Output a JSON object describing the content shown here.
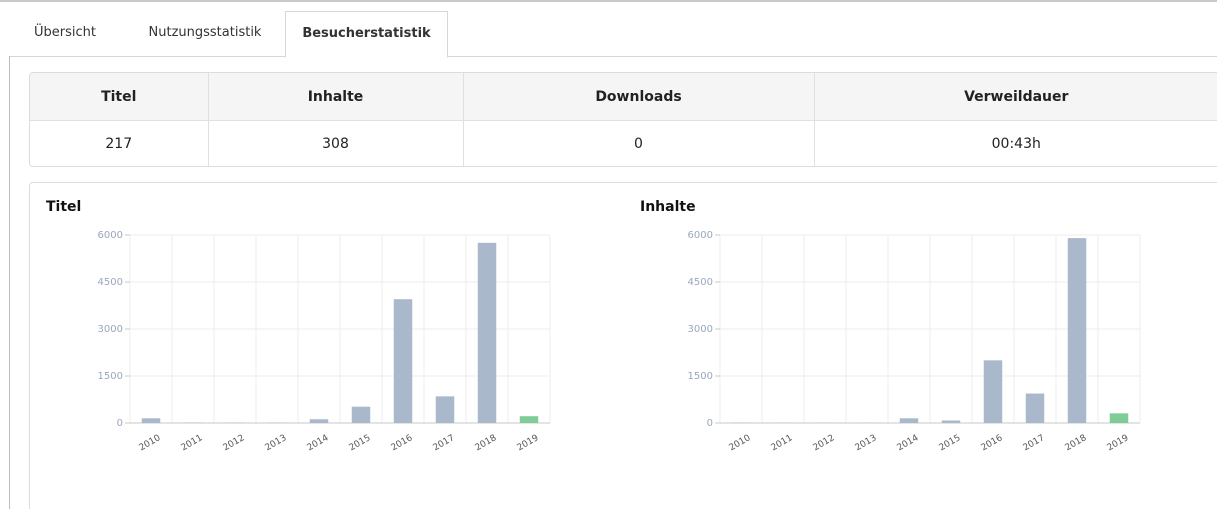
{
  "tabs": [
    {
      "label": "Übersicht",
      "active": false
    },
    {
      "label": "Nutzungsstatistik",
      "active": false
    },
    {
      "label": "Besucherstatistik",
      "active": true
    }
  ],
  "stats": {
    "headers": [
      "Titel",
      "Inhalte",
      "Downloads",
      "Verweildauer"
    ],
    "values": [
      "217",
      "308",
      "0",
      "00:43h"
    ]
  },
  "colors": {
    "bar": "#a9b8ca",
    "bar_highlight": "#7fcc98",
    "grid": "#ececec",
    "axis": "#c8c8c8"
  },
  "chart_data": [
    {
      "type": "bar",
      "title": "Titel",
      "categories": [
        "2010",
        "2011",
        "2012",
        "2013",
        "2014",
        "2015",
        "2016",
        "2017",
        "2018",
        "2019"
      ],
      "values": [
        150,
        15,
        10,
        10,
        120,
        520,
        3950,
        850,
        5750,
        217
      ],
      "highlight_index": 9,
      "yticks": [
        0,
        1500,
        3000,
        4500,
        6000
      ],
      "ylim": [
        0,
        6000
      ],
      "grid": true
    },
    {
      "type": "bar",
      "title": "Inhalte",
      "categories": [
        "2010",
        "2011",
        "2012",
        "2013",
        "2014",
        "2015",
        "2016",
        "2017",
        "2018",
        "2019"
      ],
      "values": [
        10,
        5,
        5,
        5,
        150,
        80,
        2000,
        940,
        5900,
        308
      ],
      "highlight_index": 9,
      "yticks": [
        0,
        1500,
        3000,
        4500,
        6000
      ],
      "ylim": [
        0,
        6000
      ],
      "grid": true
    }
  ]
}
